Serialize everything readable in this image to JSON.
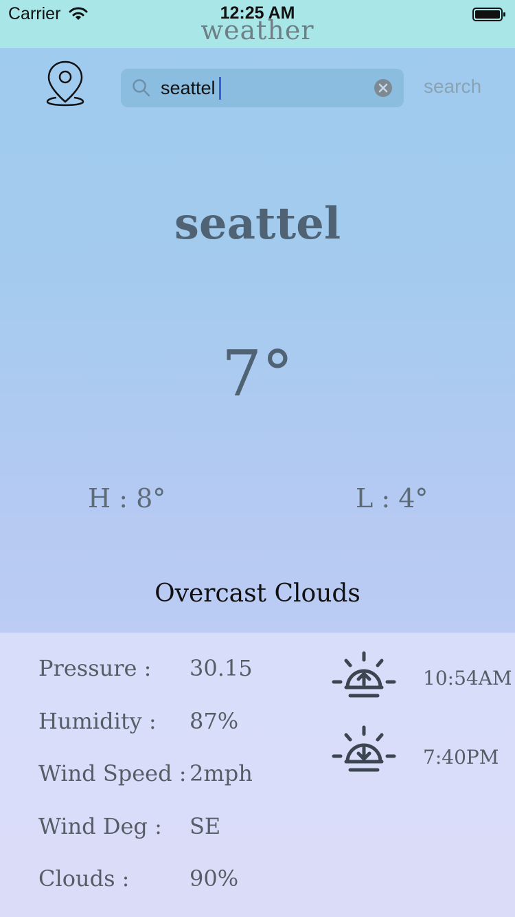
{
  "status_bar": {
    "carrier": "Carrier",
    "time": "12:25 AM",
    "icons": [
      "wifi-icon",
      "battery-icon"
    ]
  },
  "app": {
    "title": "weather"
  },
  "search": {
    "value": "seattel",
    "button_label": "search",
    "icons": [
      "search-icon",
      "clear-icon"
    ]
  },
  "location": {
    "icon": "location-pin-icon"
  },
  "weather": {
    "city": "seattel",
    "temperature": "7°",
    "high": "H : 8°",
    "low": "L : 4°",
    "condition": "Overcast Clouds"
  },
  "details": [
    {
      "label": "Pressure :",
      "value": "30.15"
    },
    {
      "label": "Humidity :",
      "value": "87%"
    },
    {
      "label": "Wind Speed :",
      "value": "2mph"
    },
    {
      "label": "Wind Deg :",
      "value": "SE"
    },
    {
      "label": "Clouds :",
      "value": "90%"
    }
  ],
  "sun": {
    "sunrise": {
      "icon": "sunrise-icon",
      "time": "10:54AM"
    },
    "sunset": {
      "icon": "sunset-icon",
      "time": "7:40PM"
    }
  },
  "colors": {
    "status_bar": "#a8e6e8",
    "sky_top": "#9ecbef",
    "sky_bottom": "#bcccf4",
    "details_panel": "#d8defa",
    "primary_text": "#4f6375",
    "search_field": "#8bbde0",
    "cursor": "#3b5bd6"
  }
}
